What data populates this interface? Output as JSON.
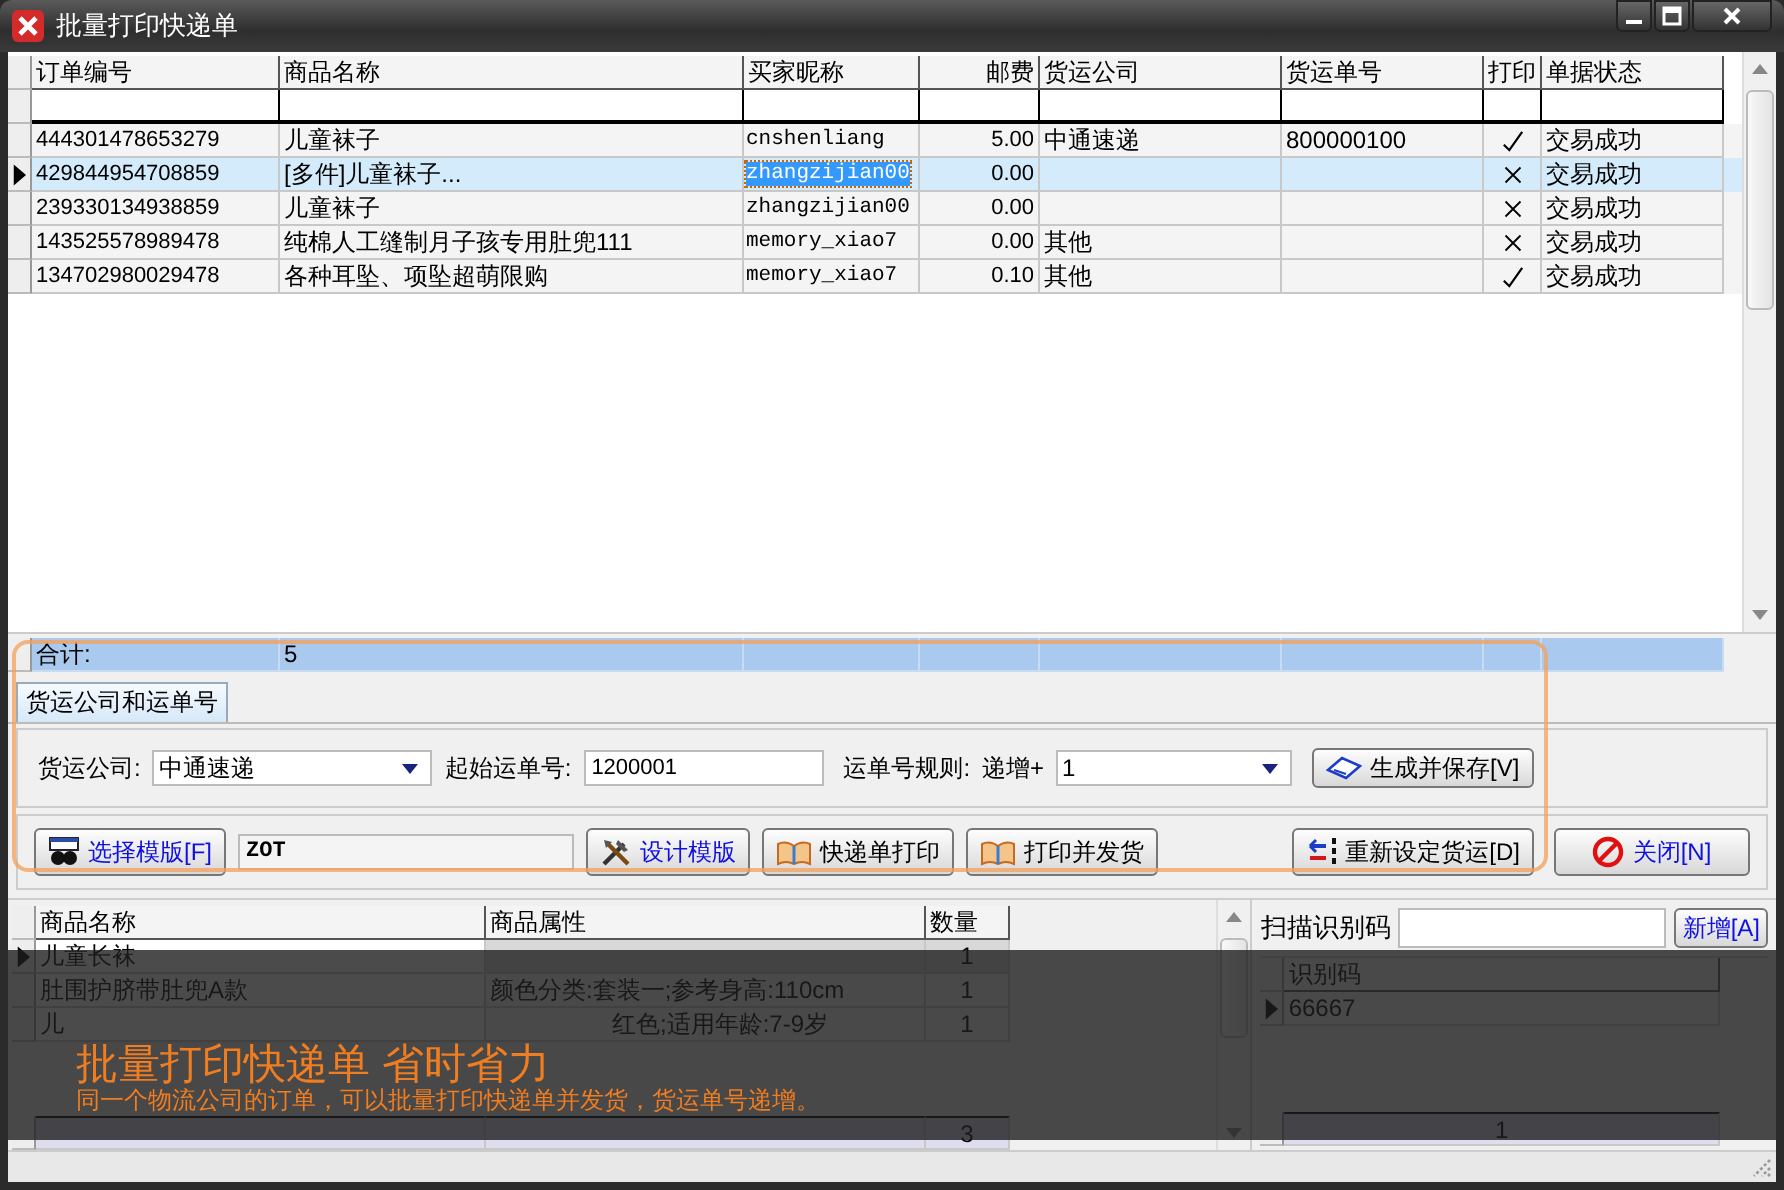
{
  "window": {
    "title": "批量打印快递单"
  },
  "orders": {
    "columns": [
      "订单编号",
      "商品名称",
      "买家昵称",
      "邮费",
      "货运公司",
      "货运单号",
      "打印",
      "单据状态"
    ],
    "rows": [
      {
        "order_no": "444301478653279",
        "product": "儿童袜子",
        "buyer": "cnshenliang",
        "postage": "5.00",
        "carrier": "中通速递",
        "tracking_no": "800000100",
        "printed": true,
        "status": "交易成功",
        "selected": false
      },
      {
        "order_no": "429844954708859",
        "product": "[多件]儿童袜子...",
        "buyer": "zhangzijian00",
        "postage": "0.00",
        "printed": false,
        "status": "交易成功",
        "selected": true
      },
      {
        "order_no": "239330134938859",
        "product": "儿童袜子",
        "buyer": "zhangzijian00",
        "postage": "0.00",
        "printed": false,
        "status": "交易成功",
        "selected": false
      },
      {
        "order_no": "143525578989478",
        "product": "纯棉人工缝制月子孩专用肚兜111",
        "buyer": "memory_xiao7",
        "postage": "0.00",
        "carrier": "其他",
        "printed": false,
        "status": "交易成功",
        "selected": false
      },
      {
        "order_no": "134702980029478",
        "product": "各种耳坠、项坠超萌限购",
        "buyer": "memory_xiao7",
        "postage": "0.10",
        "carrier": "其他",
        "printed": true,
        "status": "交易成功",
        "selected": false
      }
    ],
    "total": {
      "label": "合计:",
      "count": "5"
    }
  },
  "tabs": [
    {
      "label": "货运公司和运单号",
      "selected": true
    }
  ],
  "shipping": {
    "carrier_label": "货运公司:",
    "carrier": "中通速递",
    "start_label": "起始运单号:",
    "start_no": "1200001",
    "rule_label": "运单号规则:",
    "rule_prefix": "递增+",
    "rule_value": "1",
    "generate_button": "生成并保存[V]"
  },
  "template": {
    "value": "ZOT"
  },
  "actions": [
    {
      "kind": "select",
      "label": "选择模版[F]"
    },
    {
      "kind": "design",
      "label": "设计模版"
    },
    {
      "kind": "print",
      "label": "快递单打印"
    },
    {
      "kind": "print-ship",
      "label": "打印并发货"
    },
    {
      "kind": "reset",
      "label": "重新设定货运[D]"
    },
    {
      "kind": "close",
      "label": "关闭[N]"
    }
  ],
  "items": {
    "columns": [
      "商品名称",
      "商品属性",
      "数量"
    ],
    "rows": [
      {
        "name": "儿童长袜",
        "qty": "1",
        "selected": true
      },
      {
        "name": "肚围护脐带肚兜A款",
        "attribute": "颜色分类:套装一;参考身高:110cm",
        "qty": "1",
        "selected": false
      },
      {
        "name": "儿",
        "attribute": "红色;适用年龄:7-9岁",
        "qty": "1",
        "selected": false
      }
    ],
    "total": "3"
  },
  "scan": {
    "label": "扫描识别码",
    "button": "新增[A]",
    "columns": [
      "识别码"
    ],
    "rows": [
      {
        "code": "66667",
        "selected": true
      }
    ],
    "total": "1"
  },
  "banner": {
    "title": "批量打印快递单 省时省力",
    "subtitle": "同一个物流公司的订单，可以批量打印快递单并发货，货运单号递增。"
  }
}
